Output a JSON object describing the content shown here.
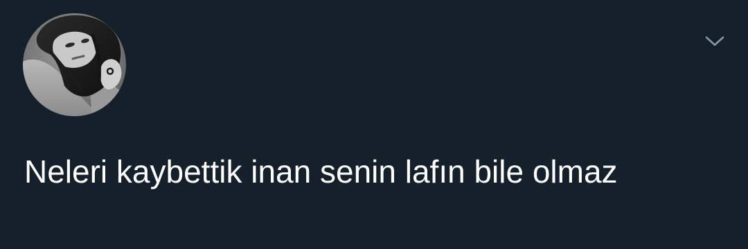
{
  "tweet": {
    "text": "Neleri kaybettik inan senin lafın bile olmaz"
  },
  "icons": {
    "avatar": "profile-photo",
    "menu": "chevron-down-icon"
  },
  "colors": {
    "background": "#15202b",
    "text": "#ffffff",
    "icon": "#8899a6"
  }
}
